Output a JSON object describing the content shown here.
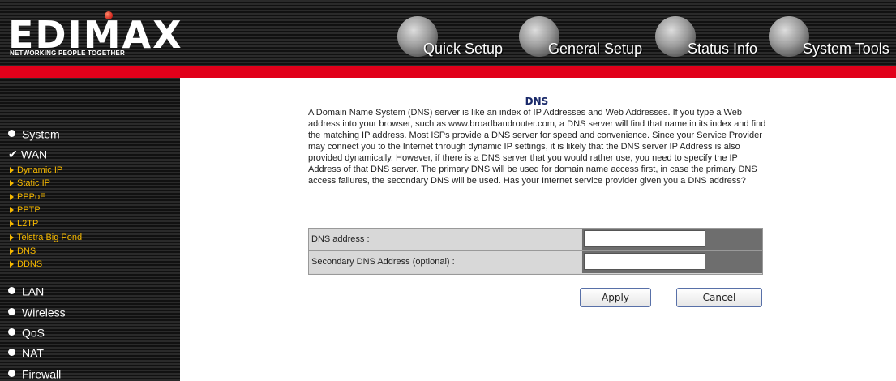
{
  "header": {
    "logo_text": "EDIMAX",
    "logo_tagline": "NETWORKING PEOPLE TOGETHER",
    "nav": [
      {
        "label": "Quick Setup",
        "icon": "globe-icon"
      },
      {
        "label": "General Setup",
        "icon": "globe-icon"
      },
      {
        "label": "Status Info",
        "icon": "globe-icon"
      },
      {
        "label": "System Tools",
        "icon": "globe-icon"
      }
    ]
  },
  "sidebar": {
    "items": [
      {
        "label": "System"
      },
      {
        "label": "WAN",
        "checked": true
      },
      {
        "label": "LAN"
      },
      {
        "label": "Wireless"
      },
      {
        "label": "QoS"
      },
      {
        "label": "NAT"
      },
      {
        "label": "Firewall"
      }
    ],
    "wan_sub": [
      {
        "label": "Dynamic IP"
      },
      {
        "label": "Static IP"
      },
      {
        "label": "PPPoE"
      },
      {
        "label": "PPTP"
      },
      {
        "label": "L2TP"
      },
      {
        "label": "Telstra Big Pond"
      },
      {
        "label": "DNS"
      },
      {
        "label": "DDNS"
      }
    ]
  },
  "main": {
    "title": "DNS",
    "description": "A Domain Name System (DNS) server is like an index of IP Addresses and Web Addresses. If you type a Web address into your browser, such as www.broadbandrouter.com, a DNS server will find that name in its index and find the matching IP address. Most ISPs provide a DNS server for speed and convenience. Since your Service Provider may connect you to the Internet through dynamic IP settings, it is likely that the DNS server IP Address is also provided dynamically. However, if there is a DNS server that you would rather use, you need to specify the IP Address of that DNS server. The primary DNS will be used for domain name access first, in case the primary DNS access failures, the secondary DNS will be used. Has your Internet service provider given you a DNS address?",
    "fields": [
      {
        "label": "DNS address :",
        "value": ""
      },
      {
        "label": "Secondary DNS Address (optional) :",
        "value": ""
      }
    ],
    "buttons": {
      "apply": "Apply",
      "cancel": "Cancel"
    }
  },
  "colors": {
    "accent_red": "#e1001a",
    "submenu_yellow": "#f5b800",
    "title_blue": "#1a2a6a"
  }
}
